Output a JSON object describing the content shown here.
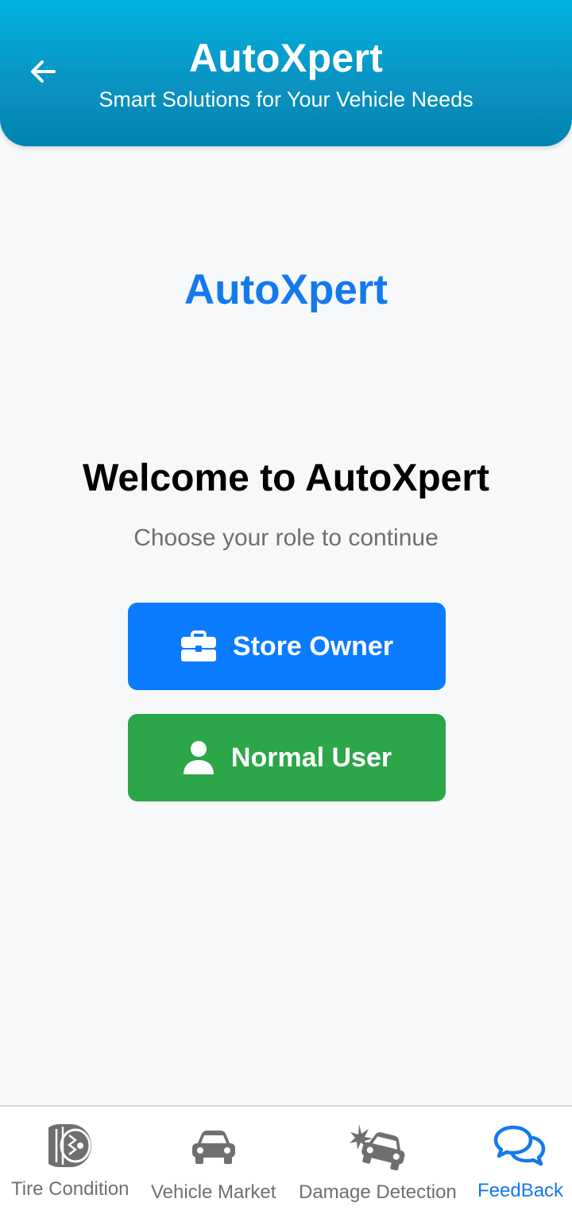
{
  "header": {
    "title": "AutoXpert",
    "subtitle": "Smart Solutions for Your Vehicle Needs",
    "back_icon": "arrow-left-icon"
  },
  "main": {
    "brand": "AutoXpert",
    "welcome": "Welcome to AutoXpert",
    "prompt": "Choose your role to continue",
    "buttons": {
      "store_owner": {
        "label": "Store Owner",
        "icon": "briefcase-icon"
      },
      "normal_user": {
        "label": "Normal User",
        "icon": "user-icon"
      }
    }
  },
  "bottom_nav": {
    "items": [
      {
        "label": "Tire Condition",
        "icon": "tire-icon",
        "active": false
      },
      {
        "label": "Vehicle Market",
        "icon": "car-icon",
        "active": false
      },
      {
        "label": "Damage Detection",
        "icon": "car-crash-icon",
        "active": false
      },
      {
        "label": "FeedBack",
        "icon": "chat-bubbles-icon",
        "active": true
      }
    ]
  },
  "colors": {
    "header_gradient_top": "#00b2e0",
    "header_gradient_bottom": "#0083b0",
    "brand_blue": "#1479ec",
    "store_owner_button": "#0b7bff",
    "normal_user_button": "#2ba648",
    "inactive_nav": "#6f6f6f",
    "background": "#f6f8fa"
  }
}
